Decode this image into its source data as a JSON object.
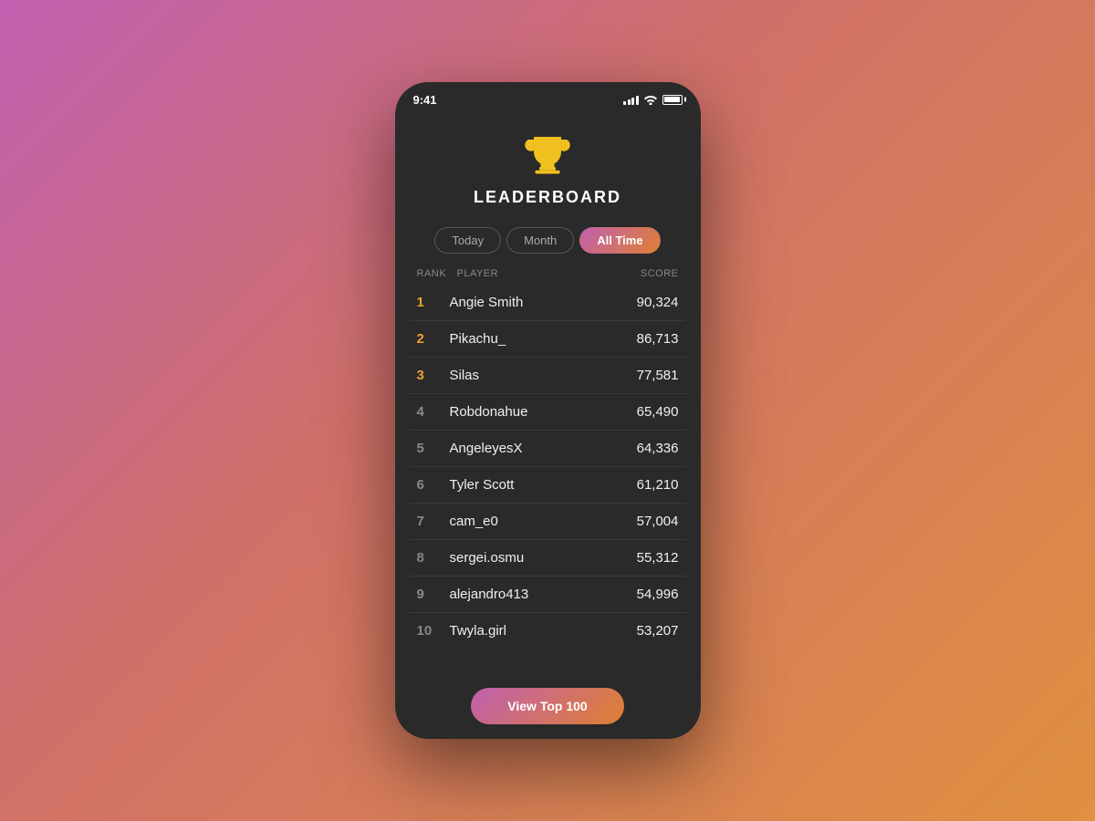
{
  "statusBar": {
    "time": "9:41"
  },
  "header": {
    "title": "LEADERBOARD"
  },
  "tabs": [
    {
      "id": "today",
      "label": "Today",
      "active": false
    },
    {
      "id": "month",
      "label": "Month",
      "active": false
    },
    {
      "id": "alltime",
      "label": "All Time",
      "active": true
    }
  ],
  "tableHeaders": {
    "rank": "Rank",
    "player": "Player",
    "score": "Score"
  },
  "players": [
    {
      "rank": "1",
      "rankClass": "gold",
      "name": "Angie Smith",
      "score": "90,324"
    },
    {
      "rank": "2",
      "rankClass": "silver",
      "name": "Pikachu_",
      "score": "86,713"
    },
    {
      "rank": "3",
      "rankClass": "bronze",
      "name": "Silas",
      "score": "77,581"
    },
    {
      "rank": "4",
      "rankClass": "",
      "name": "Robdonahue",
      "score": "65,490"
    },
    {
      "rank": "5",
      "rankClass": "",
      "name": "AngeleyesX",
      "score": "64,336"
    },
    {
      "rank": "6",
      "rankClass": "",
      "name": "Tyler Scott",
      "score": "61,210"
    },
    {
      "rank": "7",
      "rankClass": "",
      "name": "cam_e0",
      "score": "57,004"
    },
    {
      "rank": "8",
      "rankClass": "",
      "name": "sergei.osmu",
      "score": "55,312"
    },
    {
      "rank": "9",
      "rankClass": "",
      "name": "alejandro413",
      "score": "54,996"
    },
    {
      "rank": "10",
      "rankClass": "",
      "name": "Twyla.girl",
      "score": "53,207"
    }
  ],
  "viewTopButton": "View Top 100"
}
